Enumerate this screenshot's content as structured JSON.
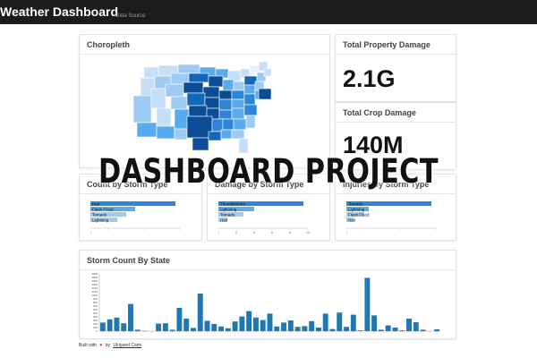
{
  "app": {
    "title": "Weather Dashboard",
    "nav_link": "Data Source"
  },
  "panels": {
    "choropleth": {
      "title": "Choropleth"
    },
    "property": {
      "title": "Total Property Damage",
      "value": "2.1G"
    },
    "crop": {
      "title": "Total Crop Damage",
      "value": "140M"
    },
    "count_type": {
      "title": "Count by Storm Type",
      "items": [
        "Hail",
        "Flash Flood",
        "Tornado",
        "Lightning"
      ],
      "values": [
        95,
        50,
        40,
        30
      ],
      "ticks": [
        "0",
        "",
        "",
        "",
        "",
        ""
      ]
    },
    "damage_type": {
      "title": "Damage by Storm Type",
      "items": [
        "Thunderstorm",
        "Lightning",
        "Tornado",
        "Hail"
      ],
      "values": [
        95,
        40,
        28,
        10
      ],
      "ticks": [
        "0",
        "2",
        "4",
        "6",
        "8",
        "10"
      ]
    },
    "injuries_type": {
      "title": "Injuries by Storm Type",
      "items": [
        "Tornado",
        "Lightning",
        "Flash Flood",
        "Hail"
      ],
      "values": [
        95,
        25,
        20,
        8
      ],
      "ticks": [
        "0",
        "",
        "",
        "",
        "",
        ""
      ]
    },
    "state_count": {
      "title": "Storm Count By State"
    }
  },
  "overlay": {
    "banner": "DASHBOARD PROJECT"
  },
  "footer": {
    "prefix": "Built with",
    "by": "by",
    "author": "Ulrigand Cami"
  },
  "chart_data": {
    "type": "bar",
    "title": "Storm Count By State",
    "values": [
      240,
      330,
      380,
      220,
      760,
      40,
      10,
      0,
      210,
      220,
      40,
      650,
      350,
      90,
      1050,
      290,
      200,
      130,
      80,
      270,
      410,
      560,
      380,
      310,
      490,
      130,
      240,
      300,
      120,
      140,
      280,
      100,
      490,
      60,
      520,
      120,
      460,
      20,
      1490,
      440,
      40,
      160,
      100,
      20,
      350,
      250,
      40,
      0,
      50
    ],
    "ylim": [
      0,
      1600
    ],
    "yticks": [
      "0",
      "100",
      "200",
      "300",
      "400",
      "500",
      "600",
      "700",
      "800",
      "900",
      "1000",
      "1100",
      "1200",
      "1300",
      "1400",
      "1500",
      "1600"
    ]
  },
  "map": {
    "colors": [
      "#e8f2fc",
      "#c6dff8",
      "#9ecbf3",
      "#5aaaee",
      "#2b86d8",
      "#1565b8",
      "#0b4c94"
    ]
  }
}
